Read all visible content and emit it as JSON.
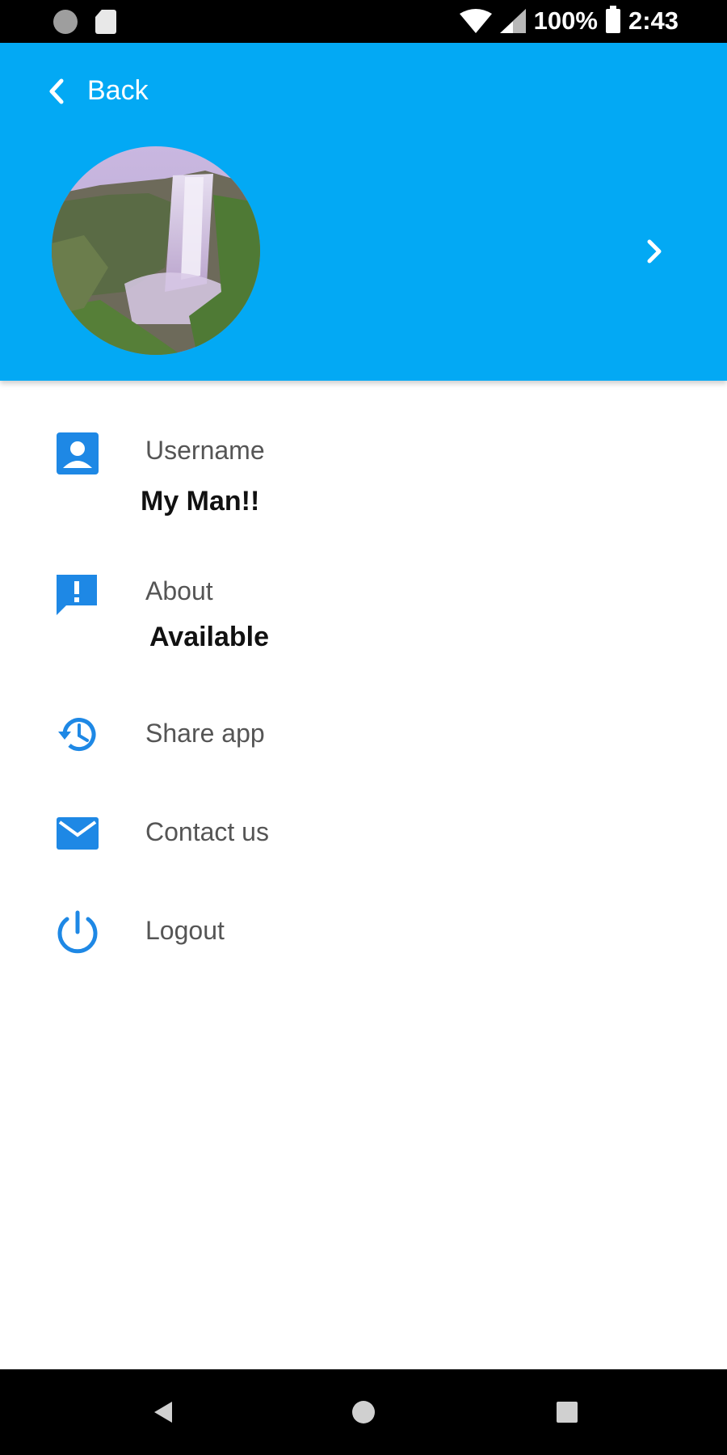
{
  "status_bar": {
    "battery": "100%",
    "time": "2:43",
    "icons": [
      "notification-dot-icon",
      "sd-card-icon",
      "wifi-icon",
      "cell-signal-icon",
      "battery-icon"
    ]
  },
  "header": {
    "back_label": "Back",
    "background_color": "#03a9f4",
    "avatar_icon": "profile-photo-waterfall",
    "forward_icon": "chevron-right-icon"
  },
  "profile": {
    "username_label": "Username",
    "username_value": "My Man!!",
    "about_label": "About",
    "about_value": "Available",
    "share_label": "Share app",
    "contact_label": "Contact us",
    "logout_label": "Logout",
    "icon_color": "#1e88e5"
  },
  "nav_bar": {
    "icons": [
      "back-triangle-icon",
      "home-circle-icon",
      "recents-square-icon"
    ]
  }
}
